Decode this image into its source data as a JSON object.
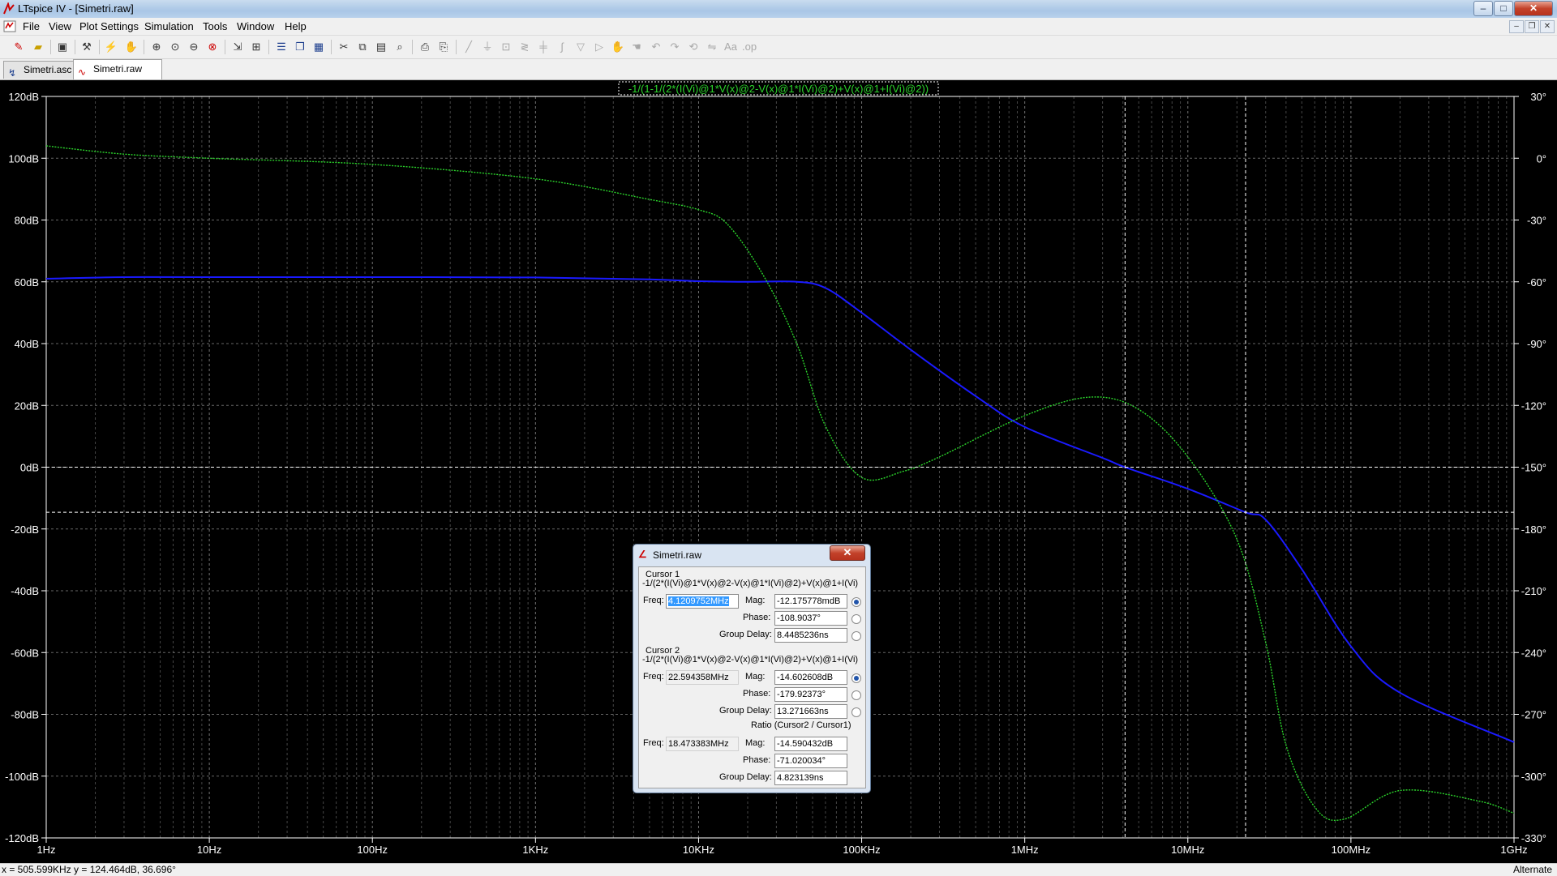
{
  "window": {
    "title": "LTspice IV - [Simetri.raw]"
  },
  "menu": [
    "File",
    "View",
    "Plot Settings",
    "Simulation",
    "Tools",
    "Window",
    "Help"
  ],
  "tabs": [
    {
      "label": "Simetri.asc",
      "icon": "schematic-icon"
    },
    {
      "label": "Simetri.raw",
      "icon": "waveform-icon"
    }
  ],
  "plot": {
    "trace_label": "-1/(1-1/(2*(I(Vi)@1*V(x)@2-V(x)@1*I(Vi)@2)+V(x)@1+I(Vi)@2))",
    "left_axis_ticks": [
      "120dB",
      "100dB",
      "80dB",
      "60dB",
      "40dB",
      "20dB",
      "0dB",
      "-20dB",
      "-40dB",
      "-60dB",
      "-80dB",
      "-100dB",
      "-120dB"
    ],
    "right_axis_ticks": [
      "30°",
      "0°",
      "-30°",
      "-60°",
      "-90°",
      "-120°",
      "-150°",
      "-180°",
      "-210°",
      "-240°",
      "-270°",
      "-300°",
      "-330°"
    ],
    "x_axis_ticks": [
      "1Hz",
      "10Hz",
      "100Hz",
      "1KHz",
      "10KHz",
      "100KHz",
      "1MHz",
      "10MHz",
      "100MHz",
      "1GHz"
    ],
    "colors": {
      "magnitude": "#1a1aff",
      "phase": "#2bd42b",
      "grid": "#808080",
      "background": "#000000"
    }
  },
  "chart_data": {
    "type": "line",
    "xscale": "log",
    "xlim": [
      1,
      1000000000
    ],
    "ylim_left": [
      -120,
      120
    ],
    "ylim_right": [
      -330,
      30
    ],
    "grid": true,
    "series": [
      {
        "name": "Magnitude",
        "axis": "left",
        "x": [
          1,
          3,
          10,
          100,
          1000,
          5000,
          10000,
          20000,
          40000,
          60000,
          100000,
          200000,
          500000,
          1000000,
          3000000,
          4120975,
          10000000,
          22594358,
          30000000,
          50000000,
          100000000,
          200000000,
          1000000000
        ],
        "y": [
          61,
          61.5,
          61.5,
          61.5,
          61.4,
          60.8,
          60.2,
          60,
          60,
          58,
          50,
          38,
          23,
          13,
          3,
          0,
          -7,
          -14.6,
          -17,
          -33,
          -58,
          -73,
          -89
        ]
      },
      {
        "name": "Phase",
        "axis": "right",
        "x": [
          1,
          3,
          10,
          100,
          1000,
          5000,
          10000,
          15000,
          25000,
          40000,
          60000,
          100000,
          180000,
          300000,
          1000000,
          2500000,
          5000000,
          10000000,
          20000000,
          30000000,
          40000000,
          60000000,
          90000000,
          200000000,
          600000000,
          1000000000
        ],
        "y": [
          6,
          2,
          0,
          -3,
          -10,
          -20,
          -25,
          -32,
          -57,
          -90,
          -130,
          -155,
          -152,
          -145,
          -125,
          -116,
          -122,
          -145,
          -185,
          -235,
          -285,
          -315,
          -321,
          -307,
          -312,
          -318
        ]
      }
    ],
    "cursors": [
      {
        "x": 4120975
      },
      {
        "x": 22594358
      }
    ]
  },
  "dialog": {
    "title": "Simetri.raw",
    "cursor1": {
      "header": "Cursor 1",
      "expr": "-1/(2*(I(Vi)@1*V(x)@2-V(x)@1*I(Vi)@2)+V(x)@1+I(Vi)",
      "freq": "4.1209752MHz",
      "mag": "-12.175778mdB",
      "phase": "-108.9037°",
      "group_delay": "8.4485236ns"
    },
    "cursor2": {
      "header": "Cursor 2",
      "expr": "-1/(2*(I(Vi)@1*V(x)@2-V(x)@1*I(Vi)@2)+V(x)@1+I(Vi)",
      "freq": "22.594358MHz",
      "mag": "-14.602608dB",
      "phase": "-179.92373°",
      "group_delay": "13.271663ns"
    },
    "ratio": {
      "header": "Ratio (Cursor2 / Cursor1)",
      "freq": "18.473383MHz",
      "mag": "-14.590432dB",
      "phase": "-71.020034°",
      "group_delay": "4.823139ns"
    },
    "labels": {
      "freq": "Freq:",
      "mag": "Mag:",
      "phase": "Phase:",
      "group_delay": "Group Delay:"
    }
  },
  "status": {
    "coords": "x = 505.599KHz    y = 124.464dB, 36.696°",
    "right": "Alternate"
  }
}
